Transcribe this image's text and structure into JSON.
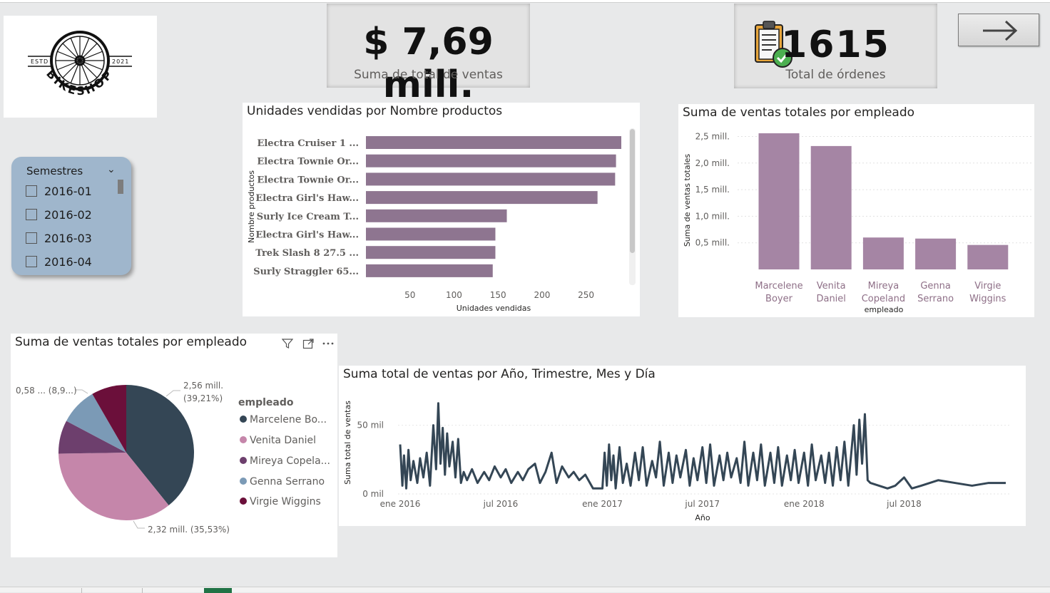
{
  "brand": {
    "logo_text": "BIKESHOP",
    "estd_left": "ESTD",
    "estd_right": "2021"
  },
  "kpi_sales": {
    "value": "$ 7,69 mill.",
    "label": "Suma de total de ventas"
  },
  "kpi_orders": {
    "value": "1615",
    "label": "Total de órdenes"
  },
  "nav": {
    "icon": "arrow-right-icon"
  },
  "slicer": {
    "title": "Semestres",
    "options": [
      "2016-01",
      "2016-02",
      "2016-03",
      "2016-04"
    ]
  },
  "colors": {
    "bar_purple": "#8e7590",
    "employee_purple": "#a585a4",
    "line_dark": "#344655",
    "pie": [
      "#344655",
      "#c586aa",
      "#6d3f6d",
      "#7b9ab6",
      "#6b0f3a"
    ]
  },
  "chart_data": [
    {
      "type": "bar",
      "orientation": "horizontal",
      "title": "Unidades vendidas por Nombre productos",
      "ylabel": "Nombre productos",
      "xlabel": "Unidades vendidas",
      "x_ticks": [
        "50",
        "100",
        "150",
        "200",
        "250"
      ],
      "xlim": [
        0,
        290
      ],
      "categories": [
        "Electra Cruiser 1 ...",
        "Electra Townie Or...",
        "Electra Townie Or...",
        "Electra Girl's Haw...",
        "Surly Ice Cream T...",
        "Electra Girl's Haw...",
        "Trek Slash 8 27.5 ...",
        "Surly Straggler 65..."
      ],
      "values": [
        290,
        284,
        283,
        263,
        160,
        147,
        147,
        144
      ]
    },
    {
      "type": "bar",
      "title": "Suma de ventas totales por empleado",
      "xlabel": "empleado",
      "ylabel": "Suma de ventas totales",
      "y_ticks": [
        "0,5 mill.",
        "1,0 mill.",
        "1,5 mill.",
        "2,0 mill.",
        "2,5 mill."
      ],
      "ylim": [
        0,
        2.6
      ],
      "categories": [
        [
          "Marcelene",
          "Boyer"
        ],
        [
          "Venita",
          "Daniel"
        ],
        [
          "Mireya",
          "Copeland"
        ],
        [
          "Genna",
          "Serrano"
        ],
        [
          "Virgie",
          "Wiggins"
        ]
      ],
      "values": [
        2.56,
        2.32,
        0.6,
        0.58,
        0.46
      ]
    },
    {
      "type": "pie",
      "title": "Suma de ventas totales por empleado",
      "legend_title": "empleado",
      "legend_position": "right",
      "legend": [
        "Marcelene Bo...",
        "Venita Daniel",
        "Mireya Copela...",
        "Genna Serrano",
        "Virgie Wiggins"
      ],
      "values": [
        39.21,
        35.53,
        8.0,
        8.9,
        8.36
      ],
      "data_labels": {
        "marcelene": [
          "2,56 mill.",
          "(39,21%)"
        ],
        "venita": "2,32 mill. (35,53%)",
        "genna": "0,58 ... (8,9...)"
      }
    },
    {
      "type": "line",
      "title": "Suma total de ventas por Año, Trimestre, Mes y Día",
      "xlabel": "Año",
      "ylabel": "Suma total de ventas",
      "x_ticks": [
        "ene 2016",
        "jul 2016",
        "ene 2017",
        "jul 2017",
        "ene 2018",
        "jul 2018"
      ],
      "y_ticks": [
        "0 mil",
        "50 mil"
      ],
      "ylim": [
        0,
        70
      ],
      "x": [
        "2016-01-01",
        "2016-01-05",
        "2016-01-08",
        "2016-01-12",
        "2016-01-16",
        "2016-01-20",
        "2016-01-25",
        "2016-02-01",
        "2016-02-06",
        "2016-02-12",
        "2016-02-18",
        "2016-02-24",
        "2016-03-01",
        "2016-03-06",
        "2016-03-10",
        "2016-03-14",
        "2016-03-18",
        "2016-03-22",
        "2016-03-26",
        "2016-03-30",
        "2016-04-05",
        "2016-04-10",
        "2016-04-15",
        "2016-04-20",
        "2016-04-25",
        "2016-05-01",
        "2016-05-10",
        "2016-05-20",
        "2016-06-01",
        "2016-06-10",
        "2016-06-20",
        "2016-07-01",
        "2016-07-10",
        "2016-07-20",
        "2016-08-01",
        "2016-08-10",
        "2016-08-20",
        "2016-09-01",
        "2016-09-10",
        "2016-09-20",
        "2016-10-01",
        "2016-10-10",
        "2016-10-20",
        "2016-11-01",
        "2016-11-10",
        "2016-11-20",
        "2016-12-01",
        "2016-12-15",
        "2017-01-01",
        "2017-01-05",
        "2017-01-09",
        "2017-01-13",
        "2017-01-17",
        "2017-01-21",
        "2017-01-25",
        "2017-02-01",
        "2017-02-07",
        "2017-02-14",
        "2017-02-21",
        "2017-03-01",
        "2017-03-08",
        "2017-03-15",
        "2017-03-22",
        "2017-04-01",
        "2017-04-08",
        "2017-04-15",
        "2017-04-22",
        "2017-05-01",
        "2017-05-08",
        "2017-05-15",
        "2017-05-22",
        "2017-06-01",
        "2017-06-08",
        "2017-06-15",
        "2017-06-22",
        "2017-07-01",
        "2017-07-08",
        "2017-07-15",
        "2017-07-22",
        "2017-08-01",
        "2017-08-08",
        "2017-08-15",
        "2017-08-22",
        "2017-09-01",
        "2017-09-08",
        "2017-09-15",
        "2017-09-22",
        "2017-10-01",
        "2017-10-08",
        "2017-10-15",
        "2017-10-22",
        "2017-11-01",
        "2017-11-08",
        "2017-11-15",
        "2017-11-22",
        "2017-12-01",
        "2017-12-08",
        "2017-12-15",
        "2017-12-22",
        "2018-01-01",
        "2018-01-08",
        "2018-01-15",
        "2018-01-22",
        "2018-02-01",
        "2018-02-08",
        "2018-02-15",
        "2018-02-22",
        "2018-03-01",
        "2018-03-08",
        "2018-03-15",
        "2018-03-22",
        "2018-04-01",
        "2018-04-06",
        "2018-04-11",
        "2018-04-16",
        "2018-04-21",
        "2018-04-26",
        "2018-05-01",
        "2018-06-01",
        "2018-06-15",
        "2018-07-01",
        "2018-07-15",
        "2018-08-01",
        "2018-09-01",
        "2018-10-01",
        "2018-11-01",
        "2018-12-01",
        "2019-01-01"
      ],
      "values": [
        36,
        6,
        28,
        4,
        32,
        10,
        24,
        8,
        26,
        12,
        30,
        6,
        50,
        18,
        66,
        22,
        48,
        14,
        44,
        20,
        38,
        12,
        40,
        8,
        16,
        10,
        18,
        8,
        16,
        10,
        20,
        12,
        18,
        8,
        16,
        10,
        18,
        22,
        8,
        16,
        30,
        8,
        20,
        12,
        16,
        10,
        14,
        4,
        4,
        30,
        6,
        36,
        10,
        28,
        4,
        34,
        8,
        22,
        6,
        30,
        10,
        34,
        6,
        24,
        12,
        38,
        6,
        30,
        8,
        28,
        12,
        32,
        6,
        26,
        10,
        34,
        8,
        36,
        6,
        28,
        10,
        30,
        12,
        26,
        8,
        38,
        6,
        30,
        10,
        36,
        6,
        30,
        8,
        34,
        6,
        28,
        10,
        32,
        8,
        30,
        6,
        36,
        10,
        28,
        8,
        30,
        6,
        34,
        10,
        38,
        6,
        50,
        14,
        54,
        22,
        58,
        10,
        8,
        4,
        6,
        12,
        4,
        6,
        10,
        8,
        6,
        8,
        8
      ]
    }
  ],
  "pie_visual": {
    "filter_icon": "filter-icon",
    "focus_icon": "focus-mode-icon",
    "more_icon": "more-options-icon"
  }
}
